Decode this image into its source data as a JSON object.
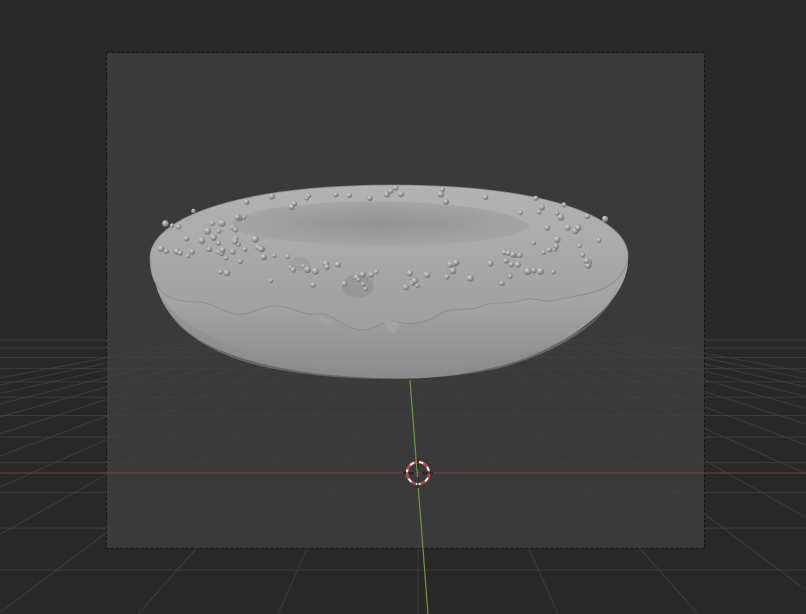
{
  "viewport": {
    "background": "#282828",
    "camera_frame_fill": "#3a3a3a",
    "camera_frame_border": "#141414",
    "grid_color": "#343434",
    "x_axis_color": "#8a3a45",
    "y_axis_color": "#6a9a3a",
    "cursor_red": "#d23a3a",
    "cursor_white": "#f0f0f0",
    "model_color": "#a8a8a8"
  },
  "scene": {
    "object": "donut-with-icing-and-sprinkles",
    "cursor_icon": "3d-cursor-icon"
  }
}
